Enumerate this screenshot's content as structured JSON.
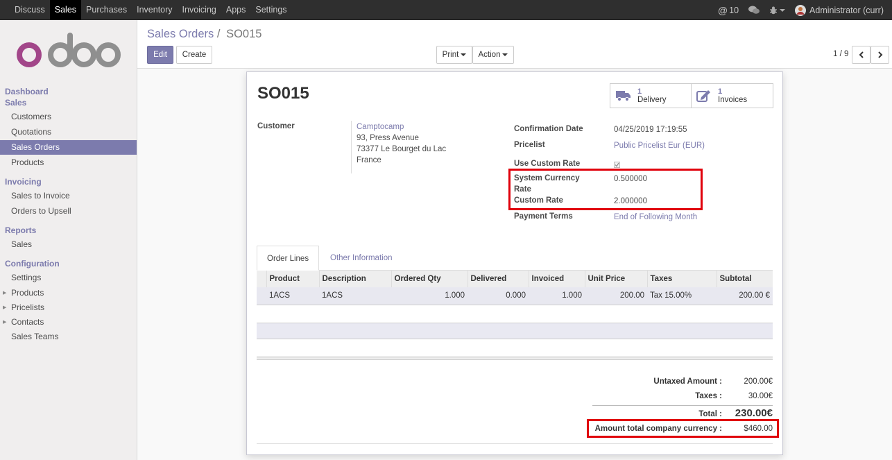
{
  "topbar": {
    "menu": [
      "Discuss",
      "Sales",
      "Purchases",
      "Inventory",
      "Invoicing",
      "Apps",
      "Settings"
    ],
    "active_menu": "Sales",
    "mentions": "10",
    "user": "Administrator (curr)"
  },
  "sidebar": {
    "sections": [
      {
        "title": "Dashboard"
      },
      {
        "title": "Sales",
        "items": [
          "Customers",
          "Quotations",
          "Sales Orders",
          "Products"
        ]
      },
      {
        "title": "Invoicing",
        "items": [
          "Sales to Invoice",
          "Orders to Upsell"
        ]
      },
      {
        "title": "Reports",
        "items": [
          "Sales"
        ]
      },
      {
        "title": "Configuration",
        "items": [
          "Settings",
          "Products",
          "Pricelists",
          "Contacts",
          "Sales Teams"
        ]
      }
    ],
    "active_item": "Sales Orders"
  },
  "control_panel": {
    "breadcrumb_parent": "Sales Orders",
    "breadcrumb_separator": "/",
    "breadcrumb_current": "SO015",
    "edit_label": "Edit",
    "create_label": "Create",
    "print_label": "Print",
    "action_label": "Action",
    "pager": "1 / 9"
  },
  "form": {
    "title": "SO015",
    "smart_buttons": [
      {
        "count": "1",
        "label": "Delivery",
        "icon": "truck-icon"
      },
      {
        "count": "1",
        "label": "Invoices",
        "icon": "pencil-square-icon"
      }
    ],
    "customer_label": "Customer",
    "customer_name": "Camptocamp",
    "customer_address": [
      "93, Press Avenue",
      "73377 Le Bourget du Lac",
      "France"
    ],
    "confirmation_date_label": "Confirmation Date",
    "confirmation_date": "04/25/2019 17:19:55",
    "pricelist_label": "Pricelist",
    "pricelist": "Public Pricelist Eur (EUR)",
    "use_custom_rate_label": "Use Custom Rate",
    "use_custom_rate": true,
    "system_currency_rate_label_1": "System Currency",
    "system_currency_rate_label_2": "Rate",
    "system_currency_rate": "0.500000",
    "custom_rate_label": "Custom Rate",
    "custom_rate": "2.000000",
    "payment_terms_label": "Payment Terms",
    "payment_terms": "End of Following Month"
  },
  "tabs": [
    "Order Lines",
    "Other Information"
  ],
  "order_lines": {
    "columns": [
      "Product",
      "Description",
      "Ordered Qty",
      "Delivered",
      "Invoiced",
      "Unit Price",
      "Taxes",
      "Subtotal"
    ],
    "rows": [
      [
        "1ACS",
        "1ACS",
        "1.000",
        "0.000",
        "1.000",
        "200.00",
        "Tax 15.00%",
        "200.00 €"
      ]
    ]
  },
  "totals": {
    "untaxed_label": "Untaxed Amount :",
    "untaxed": "200.00€",
    "taxes_label": "Taxes :",
    "taxes": "30.00€",
    "total_label": "Total :",
    "total": "230.00€",
    "company_total_label": "Amount total company currency :",
    "company_total": "$460.00"
  },
  "colors": {
    "brand": "#7c7bad",
    "highlight": "#e0000b",
    "topbar": "#2f2f2f"
  }
}
